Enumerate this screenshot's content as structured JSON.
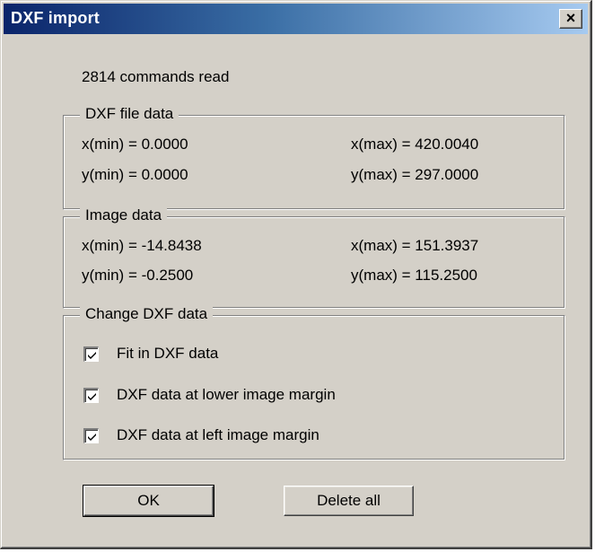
{
  "window": {
    "title": "DXF import",
    "close_glyph": "×"
  },
  "status": "2814 commands read",
  "dxf_file_data": {
    "legend": "DXF file data",
    "xmin": "x(min) = 0.0000",
    "xmax": "x(max) = 420.0040",
    "ymin": "y(min) = 0.0000",
    "ymax": "y(max) = 297.0000"
  },
  "image_data": {
    "legend": "Image data",
    "xmin": "x(min) = -14.8438",
    "xmax": "x(max) = 151.3937",
    "ymin": "y(min) = -0.2500",
    "ymax": "y(max) = 115.2500"
  },
  "change_dxf_data": {
    "legend": "Change DXF data",
    "options": [
      {
        "label": "Fit in DXF data",
        "checked": true
      },
      {
        "label": "DXF data at lower image margin",
        "checked": true
      },
      {
        "label": "DXF data at left image margin",
        "checked": true
      }
    ]
  },
  "buttons": {
    "ok": "OK",
    "delete_all": "Delete all"
  },
  "colors": {
    "face": "#d4d0c8",
    "title_start": "#0a246a",
    "title_end": "#a6caf0"
  }
}
